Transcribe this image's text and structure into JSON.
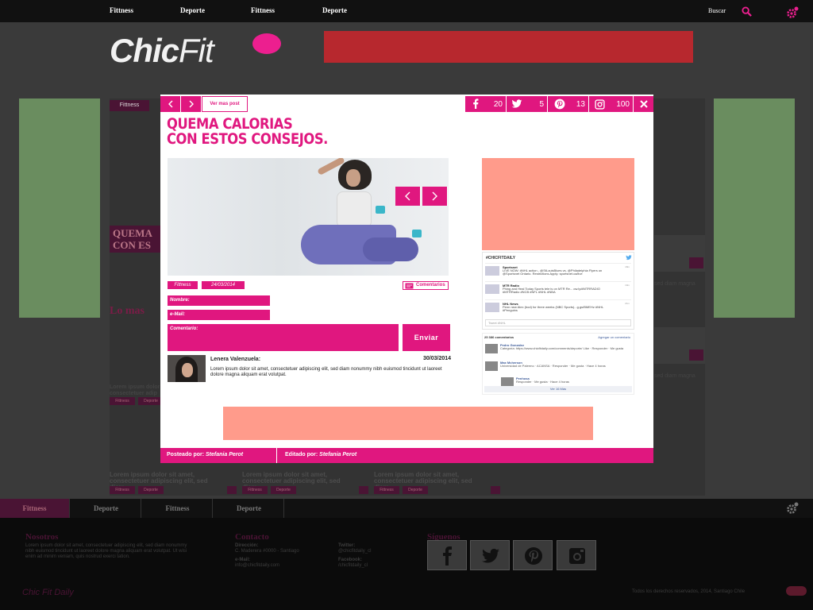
{
  "topbar": {
    "nav": [
      "Fittness",
      "Deporte",
      "Fittness",
      "Deporte"
    ],
    "search_label": "Buscar"
  },
  "logo": {
    "part1": "Chic",
    "part2": "Fit"
  },
  "background": {
    "tag": "Fittness",
    "title": "QUEMA CON ES",
    "mas": "Lo mas",
    "right_snippets": [
      "sed diam magna",
      "sed diam magna"
    ],
    "left_snippets": [
      "Lorem ipsum dolor",
      "consectetuer adip"
    ],
    "card_texts": [
      "Lorem ipsum dolor sit amet, consectetuer adipiscing elit, sed diam",
      "Lorem ipsum dolor sit amet, consectetuer adipiscing elit, sed diam",
      "Lorem ipsum dolor sit amet, consectetuer adipiscing elit, sed diam"
    ],
    "chips": [
      "Fittness",
      "Deporte"
    ]
  },
  "bottom_nav": [
    "Fittness",
    "Deporte",
    "Fittness",
    "Deporte"
  ],
  "footer": {
    "col1_head": "Nosotros",
    "col1_text": "Lorem ipsum dolor sit amet, consectetuer adipiscing elit, sed diam nonummy nibh euismod tincidunt ut laoreet dolore magna aliquam erat volutpat. Ut wisi enim ad minim veniam, quis nostrud exerci tation.",
    "col2_head": "Contacto",
    "dir_label": "Dirección:",
    "dir_value": "C. Maderera #0000 - Santiago",
    "mail_label": "e-Mail:",
    "mail_value": "info@chicfitdaily.com",
    "tw_label": "Twitter:",
    "tw_value": "@chicfitdaily_cl",
    "fb_label": "Facebook:",
    "fb_value": "/chicfitdaily_cl",
    "col3_head": "Síguenos",
    "logo_text": "Chic Fit Daily",
    "copyright": "Todos los derechos reservados, 2014, Santiago Chile"
  },
  "modal": {
    "toolbar": {
      "ver_mas": "Ver mas post",
      "facebook_count": "20",
      "twitter_count": "5",
      "pinterest_count": "13",
      "instagram_count": "100"
    },
    "title_line1": "QUEMA CALORIAS",
    "title_line2": "CON ESTOS CONSEJOS.",
    "category": "Fittness",
    "date": "24/03/2014",
    "comentarios": "Comentarios",
    "form": {
      "nombre": "Nombre:",
      "email": "e-Mail:",
      "comentario": "Comentario:",
      "enviar": "Enviar"
    },
    "comment": {
      "name": "Lenera Valenzuela:",
      "date": "30/03/2014",
      "text": "Lorem ipsum dolor sit amet, consectetuer adipiscing elit, sed diam nonummy nibh euismod tincidunt ut laoreet dolore magna aliquam erat volutpat."
    },
    "twitter_widget": {
      "title": "#CHICFITDAILY",
      "tweets": [
        {
          "name": "Sportsnet",
          "text": "LIVE NOW: #NHL action - @StLouisBlues vs. @Philadelphia Flyers on @Sportsnet Ontario. Restrictions Apply: sportsnet.ca/live",
          "time": "18m"
        },
        {
          "name": "MTR Radio",
          "text": "Phing and Heal Today Sports tele is on MTR Re... ow.ly/#MTRRADIO #MTRRadio #NCB #NFL #NHL #NBA",
          "time": "19m"
        },
        {
          "name": "NHL News",
          "text": "Penn new Alex (bod) for three weeks (NBC Sports)...g.gs/BMEHz #NHL #Penguins",
          "time": "21m"
        }
      ],
      "input_placeholder": "Tweet #NHL"
    },
    "facebook_widget": {
      "count_label": "25 386 comentarios",
      "add_label": "Agregar un comentario",
      "comments": [
        {
          "name": "Pedro Gonzalez",
          "text": "Categoría: https://www.chicfitdaily.com/comments/deporte/ Like · Responder · Me gusta"
        },
        {
          "name": "Max Mcherson",
          "text": "Universidad de Palermo · ACANSA · Responder · Me gusta · Hace 4 horas"
        },
        {
          "name": "Penhosa",
          "text": "Responder · Me gusta · Hace 4 horas"
        }
      ],
      "more": "Ver 16 Más"
    },
    "footer": {
      "posteado_label": "Posteado por:",
      "posteado_name": "Stefania Perot",
      "editado_label": "Editado por:",
      "editado_name": "Stefania Perot"
    }
  },
  "colors": {
    "accent": "#e0177f",
    "ad_salmon": "#ff9b8b",
    "banner_red": "#b7282e",
    "side_green": "#6a8d5f"
  }
}
